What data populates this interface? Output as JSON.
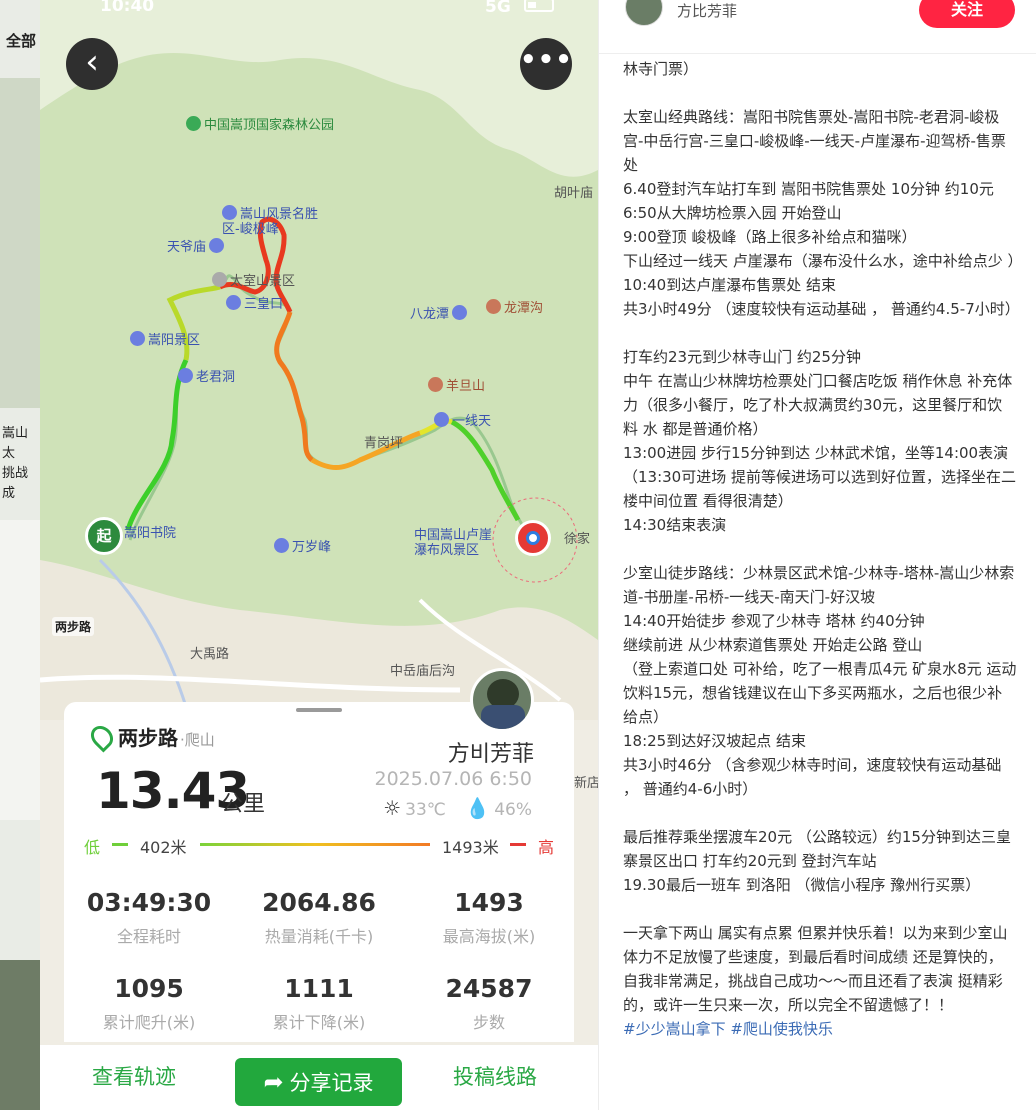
{
  "background_feed": {
    "tab_label": "全部",
    "card_title_fragment": "嵩山太\n挑战成"
  },
  "status_bar": {
    "time": "10:40",
    "network": "5G"
  },
  "map": {
    "labels": {
      "forest_park": "中国嵩顶国家森林公园",
      "junji_peak": "嵩山风景名胜\n区-峻极峰",
      "tianye_temple": "天爷庙",
      "taishi_area": "太室山景区",
      "sanhuang": "三皇口",
      "songyang_area": "嵩阳景区",
      "laojun_cave": "老君洞",
      "qinggang": "青岗坪",
      "yixiantian": "一线天",
      "yangdan": "羊旦山",
      "balong": "八龙潭",
      "longtan": "龙潭沟",
      "huye": "胡叶庙",
      "lu_waterfall": "中国嵩山卢崖\n瀑布风景区",
      "xujia": "徐家",
      "wansui": "万岁峰",
      "songyang_academy": "嵩阳书院",
      "dayu": "大禹路",
      "zhongyue": "中岳庙后沟",
      "xindian": "新店",
      "start": "起",
      "watermark": "两步路"
    },
    "icons": [
      "back-arrow-icon",
      "more-dots-icon"
    ]
  },
  "stats_card": {
    "brand": "两步路",
    "activity": "·爬山",
    "username": "方비芳菲",
    "distance": "13.43",
    "distance_unit": "公里",
    "datetime": "2025.07.06 6:50",
    "temperature": "33℃",
    "humidity": "46%",
    "elevation": {
      "low_label": "低",
      "low_value": "402米",
      "high_value": "1493米",
      "high_label": "高"
    },
    "stats": [
      {
        "value": "03:49:30",
        "label": "全程耗时"
      },
      {
        "value": "2064.86",
        "label": "热量消耗(千卡)"
      },
      {
        "value": "1493",
        "label": "最高海拔(米)"
      },
      {
        "value": "1095",
        "label": "累计爬升(米)"
      },
      {
        "value": "1111",
        "label": "累计下降(米)"
      },
      {
        "value": "24587",
        "label": "步数"
      }
    ]
  },
  "actions": {
    "view_track": "查看轨迹",
    "share": "分享记录",
    "submit_route": "投稿线路"
  },
  "post": {
    "author": "方比芳菲",
    "follow_label": "关注",
    "lines": [
      "林寺门票）",
      "",
      "太室山经典路线：嵩阳书院售票处-嵩阳书院-老君洞-峻极宫-中岳行宫-三皇口-峻极峰-一线天-卢崖瀑布-迎驾桥-售票处",
      "6.40登封汽车站打车到 嵩阳书院售票处 10分钟 约10元",
      "6:50从大牌坊检票入园 开始登山",
      "9:00登顶 峻极峰（路上很多补给点和猫咪）",
      "下山经过一线天 卢崖瀑布（瀑布没什么水，途中补给点少 ）",
      "10:40到达卢崖瀑布售票处 结束",
      "共3小时49分 （速度较快有运动基础 ， 普通约4.5-7小时）",
      "",
      "打车约23元到少林寺山门 约25分钟",
      "中午 在嵩山少林牌坊检票处门口餐店吃饭 稍作休息 补充体力（很多小餐厅，吃了朴大叔满贯约30元，这里餐厅和饮料 水 都是普通价格）",
      "13:00进园 步行15分钟到达 少林武术馆，坐等14:00表演 （13:30可进场 提前等候进场可以选到好位置，选择坐在二楼中间位置 看得很清楚）",
      "14:30结束表演",
      "",
      "少室山徒步路线：少林景区武术馆-少林寺-塔林-嵩山少林索道-书册崖-吊桥-一线天-南天门-好汉坡",
      "14:40开始徒步 参观了少林寺 塔林 约40分钟",
      "继续前进 从少林索道售票处 开始走公路 登山",
      "（登上索道口处 可补给，吃了一根青瓜4元 矿泉水8元 运动饮料15元，想省钱建议在山下多买两瓶水，之后也很少补给点）",
      "18:25到达好汉坡起点 结束",
      "共3小时46分 （含参观少林寺时间，速度较快有运动基础 ， 普通约4-6小时）",
      "",
      "最后推荐乘坐摆渡车20元 （公路较远）约15分钟到达三皇寨景区出口 打车约20元到 登封汽车站",
      "19.30最后一班车 到洛阳 （微信小程序 豫州行买票）",
      "",
      "一天拿下两山 属实有点累 但累并快乐着！以为来到少室山体力不足放慢了些速度，到最后看时间成绩 还是算快的，自我非常满足，挑战自己成功～～而且还看了表演 挺精彩的，或许一生只来一次，所以完全不留遗憾了！！"
    ],
    "tags": "#少少嵩山拿下 #爬山使我快乐"
  }
}
